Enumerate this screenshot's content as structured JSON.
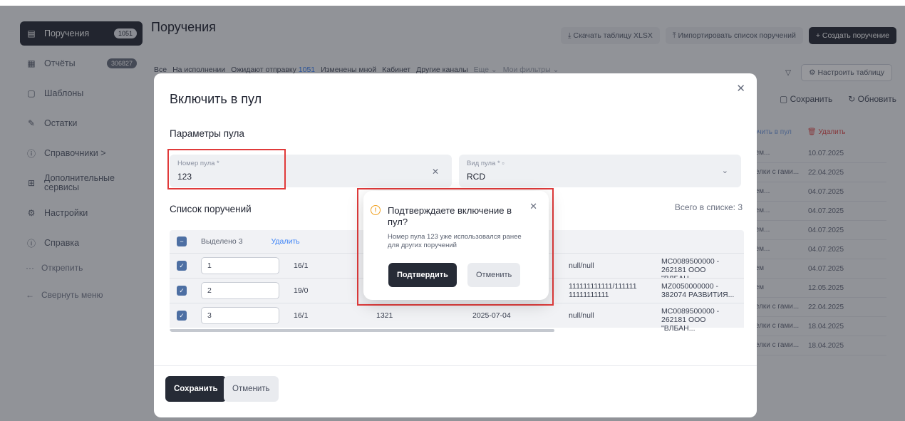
{
  "sidebar": {
    "items": [
      {
        "label": "Поручения",
        "badge": "1051",
        "icon": "document-icon"
      },
      {
        "label": "Отчёты",
        "badge": "306827",
        "icon": "report-icon"
      },
      {
        "label": "Шаблоны",
        "badge": "",
        "icon": "template-icon"
      },
      {
        "label": "Остатки",
        "badge": "",
        "icon": "edit-icon"
      },
      {
        "label": "Справочники  >",
        "badge": "",
        "icon": "info-icon"
      },
      {
        "label": "Дополнительные сервисы",
        "badge": "",
        "icon": "grid-icon"
      },
      {
        "label": "Настройки",
        "badge": "",
        "icon": "gear-icon"
      },
      {
        "label": "Справка",
        "badge": "",
        "icon": "help-icon"
      }
    ],
    "unpin": "Открепить",
    "collapse": "Свернуть меню"
  },
  "header": {
    "title": "Поручения",
    "download_xlsx": "Скачать таблицу XLSX",
    "import_list": "Импортировать список поручений",
    "create": "+ Создать поручение"
  },
  "filters": {
    "all": "Все",
    "in_progress": "На исполнении",
    "awaiting": "Ожидают отправку",
    "awaiting_count": "1051",
    "changed_by_me": "Изменены мной",
    "cabinet": "Кабинет",
    "other_channels": "Другие каналы",
    "more": "Еще",
    "my_filters": "Мои фильтры",
    "configure_table": "Настроить таблицу"
  },
  "bg_table": {
    "save": "Сохранить",
    "refresh": "Обновить",
    "include_pool": "очить в пул",
    "delete": "Удалить",
    "rows": [
      {
        "status": "ием...",
        "date": "10.07.2025"
      },
      {
        "status": "делки с гами...",
        "date": "22.04.2025"
      },
      {
        "status": "ием...",
        "date": "04.07.2025"
      },
      {
        "status": "ием...",
        "date": "04.07.2025"
      },
      {
        "status": "ием...",
        "date": "04.07.2025"
      },
      {
        "status": "ием...",
        "date": "04.07.2025"
      },
      {
        "status": "ием",
        "date": "04.07.2025"
      },
      {
        "status": "ием",
        "date": "12.05.2025"
      },
      {
        "status": "делки с гами...",
        "date": "22.04.2025"
      },
      {
        "status": "делки с гами...",
        "date": "18.04.2025"
      },
      {
        "status": "делки с гами...",
        "date": "18.04.2025"
      }
    ]
  },
  "modal": {
    "title": "Включить в пул",
    "params_title": "Параметры пула",
    "pool_number_label": "Номер пула *",
    "pool_number_value": "123",
    "pool_type_label": "Вид пула *",
    "pool_type_value": "RCD",
    "list_title": "Список поручений",
    "list_count": "Всего в списке: 3",
    "selected": "Выделено 3",
    "delete": "Удалить",
    "rows": [
      {
        "num": "1",
        "code": "16/1",
        "amount": "",
        "date": "",
        "ref": "null/null",
        "party": "MC0089500000 - 262181 ООО \"ВЛБАН..."
      },
      {
        "num": "2",
        "code": "19/0",
        "amount": "",
        "date": "",
        "ref": "111111111111/111111 11111111111",
        "party": "MZ0050000000 - 382074 РАЗВИТИЯ..."
      },
      {
        "num": "3",
        "code": "16/1",
        "amount": "1321",
        "date": "2025-07-04",
        "ref": "null/null",
        "party": "MC0089500000 - 262181 ООО \"ВЛБАН..."
      }
    ],
    "save": "Сохранить",
    "cancel": "Отменить"
  },
  "confirm": {
    "title": "Подтверждаете включение в пул?",
    "text": "Номер пула 123 уже использовался ранее для других поручений",
    "confirm": "Подтвердить",
    "cancel": "Отменить"
  },
  "colors": {
    "accent_dark": "#262b36",
    "highlight_red": "#e03a3a",
    "warning": "#f0a020",
    "checkbox": "#4d6fa3"
  }
}
